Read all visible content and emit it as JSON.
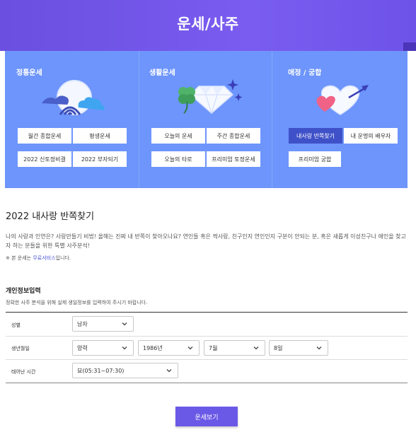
{
  "header": {
    "title": "운세/사주"
  },
  "menu": {
    "columns": [
      {
        "title": "정통운세",
        "buttons": [
          "월간 종합운세",
          "평생운세",
          "2022 신토정비결",
          "2022 부자되기"
        ]
      },
      {
        "title": "생활운세",
        "buttons": [
          "오늘의 운세",
          "주간 종합운세",
          "오늘의 타로",
          "프리미엄 토정운세"
        ]
      },
      {
        "title": "애정 / 궁합",
        "buttons": [
          "내사랑 반쪽찾기",
          "내 운명의 배우자",
          "프리미엄 궁합"
        ]
      }
    ],
    "active_button": "내사랑 반쪽찾기"
  },
  "content": {
    "title": "2022 내사랑 반쪽찾기",
    "description": "나의 사랑과 인연은? 사랑만들기 비법! 올해는 진짜 내 반쪽이 찾아오나요? 연인들 혹은 짝사랑, 친구인지 연인인지 구분이 안되는 분, 혹은 새롭게 이성친구나 애인을 찾고자 하는 분들을 위한 특별 사주분석!",
    "note_prefix": "※ 본 운세는 ",
    "note_link": "무료서비스",
    "note_suffix": "입니다."
  },
  "form": {
    "title": "개인정보입력",
    "description": "정확한 사주 분석을 위해 실제 생일정보를 입력하여 주시기 바랍니다.",
    "gender": {
      "label": "성별",
      "value": "남자"
    },
    "birthdate": {
      "label": "생년월일",
      "calendar": "양력",
      "year": "1986년",
      "month": "7월",
      "day": "8일"
    },
    "birthtime": {
      "label": "태어난 시간",
      "value": "묘(05:31~07:30)"
    },
    "submit_label": "운세보기"
  },
  "colors": {
    "header": "#6a4fe0",
    "menu_bg": "#6d95fb",
    "active_button": "#3f51c8",
    "submit": "#6a58e6",
    "link": "#4a55d6"
  }
}
